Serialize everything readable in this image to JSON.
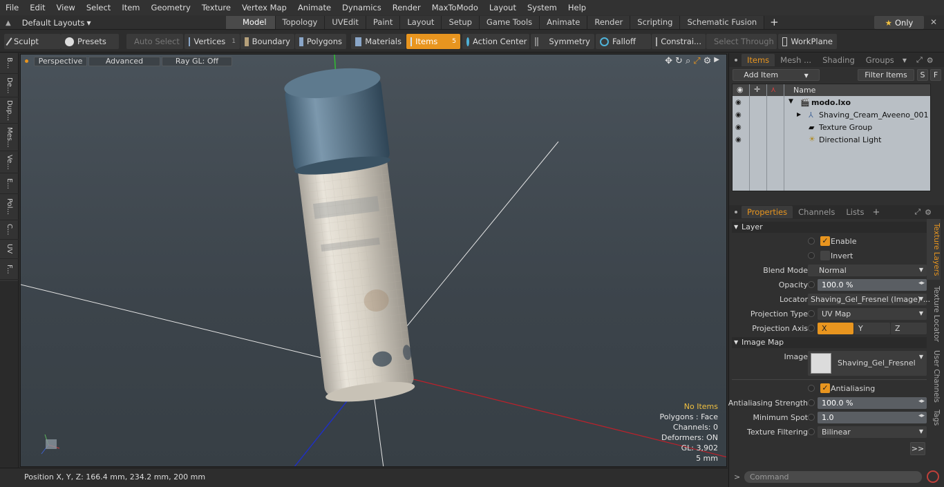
{
  "menu": [
    "File",
    "Edit",
    "View",
    "Select",
    "Item",
    "Geometry",
    "Texture",
    "Vertex Map",
    "Animate",
    "Dynamics",
    "Render",
    "MaxToModo",
    "Layout",
    "System",
    "Help"
  ],
  "layout": {
    "label": "Default Layouts",
    "tabs": [
      "Model",
      "Topology",
      "UVEdit",
      "Paint",
      "Layout",
      "Setup",
      "Game Tools",
      "Animate",
      "Render",
      "Scripting",
      "Schematic Fusion"
    ],
    "only_label": "Only"
  },
  "toolbar": {
    "sculpt": "Sculpt",
    "presets": "Presets",
    "auto_select": "Auto Select",
    "vertices": "Vertices",
    "vertices_count": "1",
    "boundary": "Boundary",
    "polygons": "Polygons",
    "materials": "Materials",
    "items": "Items",
    "items_count": "5",
    "action_center": "Action Center",
    "symmetry": "Symmetry",
    "falloff": "Falloff",
    "constraints": "Constrai...",
    "select_through": "Select Through",
    "workplane": "WorkPlane"
  },
  "left_tabs": [
    "B...",
    "De...",
    "Dup...",
    "Mes...",
    "Ve...",
    "E...",
    "Pol...",
    "C...",
    "UV",
    "F..."
  ],
  "viewport": {
    "perspective": "Perspective",
    "advanced": "Advanced",
    "raygl": "Ray GL: Off",
    "stats": {
      "no_items": "No Items",
      "polygons": "Polygons : Face",
      "channels": "Channels: 0",
      "deformers": "Deformers: ON",
      "gl": "GL: 3,902",
      "scale": "5 mm"
    }
  },
  "status": {
    "position": "Position X, Y, Z:   166.4 mm, 234.2 mm, 200 mm"
  },
  "items_panel": {
    "tabs": [
      "Items",
      "Mesh ...",
      "Shading",
      "Groups"
    ],
    "add_item": "Add Item",
    "filter_items": "Filter Items",
    "s": "S",
    "f": "F",
    "col_name": "Name",
    "rows": [
      {
        "label": "modo.lxo",
        "bold": true
      },
      {
        "label": "Shaving_Cream_Aveeno_001"
      },
      {
        "label": "Texture Group"
      },
      {
        "label": "Directional Light"
      }
    ]
  },
  "properties": {
    "tabs": [
      "Properties",
      "Channels",
      "Lists"
    ],
    "layer_header": "Layer",
    "enable": "Enable",
    "invert": "Invert",
    "blend_mode_label": "Blend Mode",
    "blend_mode": "Normal",
    "opacity_label": "Opacity",
    "opacity": "100.0 %",
    "locator_label": "Locator",
    "locator": "Shaving_Gel_Fresnel (Image) ...",
    "projection_type_label": "Projection Type",
    "projection_type": "UV Map",
    "projection_axis_label": "Projection Axis",
    "axis_x": "X",
    "axis_y": "Y",
    "axis_z": "Z",
    "image_map_header": "Image Map",
    "image_label": "Image",
    "image": "Shaving_Gel_Fresnel",
    "antialiasing": "Antialiasing",
    "aa_strength_label": "Antialiasing Strength",
    "aa_strength": "100.0 %",
    "min_spot_label": "Minimum Spot",
    "min_spot": "1.0",
    "tex_filter_label": "Texture Filtering",
    "tex_filter": "Bilinear",
    "more": ">>",
    "side_tabs": [
      "Texture Layers",
      "Texture Locator",
      "User Channels",
      "Tags"
    ]
  },
  "command": {
    "placeholder": "Command"
  },
  "colors": {
    "accent": "#e8951f",
    "x_axis": "#c0202a",
    "y_axis": "#30c030",
    "z_axis": "#2030c0"
  }
}
